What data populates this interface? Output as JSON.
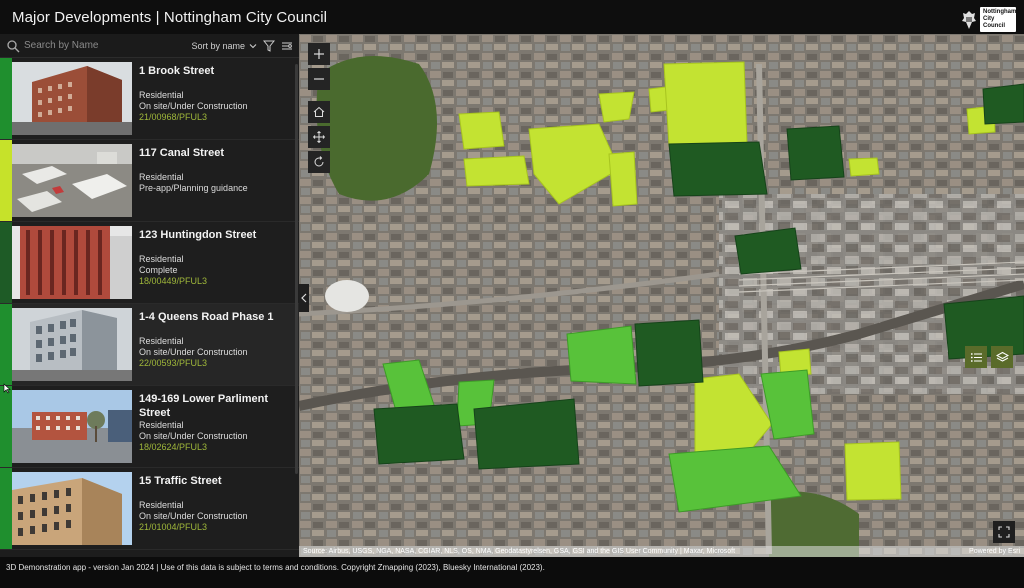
{
  "header": {
    "title": "Major Developments | Nottingham City Council",
    "logo_line1": "Nottingham",
    "logo_line2": "City Council"
  },
  "sidebar": {
    "search_placeholder": "Search by Name",
    "sort_label": "Sort by name",
    "items": [
      {
        "name": "1 Brook Street",
        "type": "Residential",
        "status": "On site/Under Construction",
        "ref": "21/00968/PFUL3",
        "status_color": "#1f8f2e"
      },
      {
        "name": "117 Canal Street",
        "type": "Residential",
        "status": "Pre-app/Planning guidance",
        "ref": "",
        "status_color": "#c6e22a"
      },
      {
        "name": "123 Huntingdon Street",
        "type": "Residential",
        "status": "Complete",
        "ref": "18/00449/PFUL3",
        "status_color": "#1e5b26"
      },
      {
        "name": "1-4 Queens Road Phase 1",
        "type": "Residential",
        "status": "On site/Under Construction",
        "ref": "22/00593/PFUL3",
        "status_color": "#1f8f2e"
      },
      {
        "name": "149-169 Lower Parliment Street",
        "type": "Residential",
        "status": "On site/Under Construction",
        "ref": "18/02624/PFUL3",
        "status_color": "#1f8f2e"
      },
      {
        "name": "15 Traffic Street",
        "type": "Residential",
        "status": "On site/Under Construction",
        "ref": "21/01004/PFUL3",
        "status_color": "#1f8f2e"
      }
    ]
  },
  "map": {
    "attribution": "Source: Airbus, USGS, NGA, NASA, CGIAR, NLS, OS, NMA, Geodatastyrelsen, GSA, GSI and the GIS User Community | Maxar, Microsoft",
    "powered_by": "Powered by Esri"
  },
  "footer": {
    "text": "3D Demonstration app - version Jan 2024 | Use of this data is subject to terms and conditions. Copyright Zmapping (2023), Bluesky International (2023)."
  }
}
